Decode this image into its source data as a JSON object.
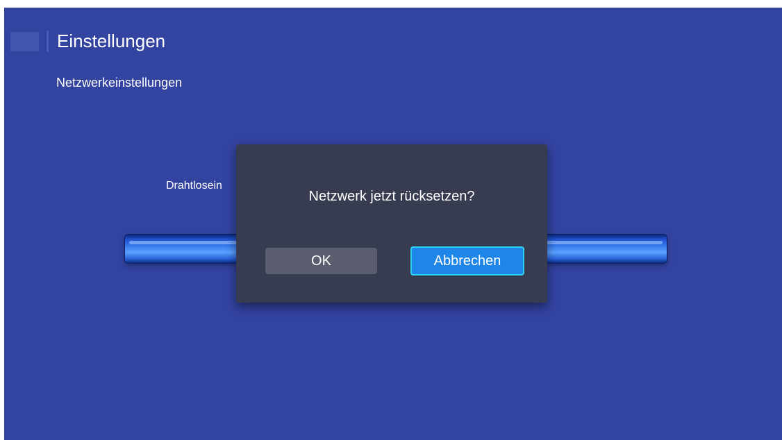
{
  "header": {
    "title": "Einstellungen",
    "subtitle": "Netzwerkeinstellungen"
  },
  "background": {
    "item_label": "Drahtlosein"
  },
  "dialog": {
    "message": "Netzwerk jetzt rücksetzen?",
    "ok_label": "OK",
    "cancel_label": "Abbrechen",
    "focused_button": "cancel"
  },
  "colors": {
    "screen_background": "#3343a0",
    "dialog_background": "#383c50",
    "focus_button": "#1d86e8",
    "focus_border": "#2fd0ea",
    "default_button": "#5b5e6e"
  }
}
